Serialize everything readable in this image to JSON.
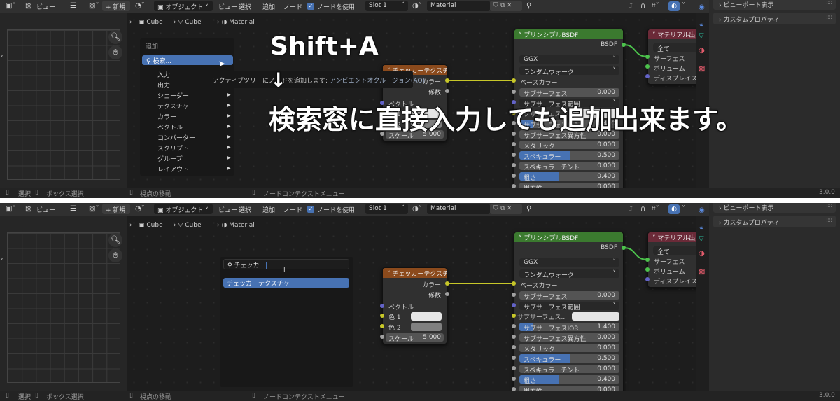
{
  "header": {
    "image_editor": {
      "view": "ビュー",
      "new": "新規"
    },
    "node_editor": {
      "mode": "オブジェクト",
      "menus": [
        "ビュー",
        "選択",
        "追加",
        "ノード"
      ],
      "use_nodes_label": "ノードを使用",
      "use_nodes_checked": true,
      "slot": "Slot 1",
      "material": "Material"
    }
  },
  "breadcrumb": [
    "Cube",
    "Cube",
    "Material"
  ],
  "properties": {
    "sections": [
      "ビューポート表示",
      "カスタムプロパティ"
    ]
  },
  "status": {
    "select": "選択",
    "box_select": "ボックス選択",
    "pan": "視点の移動",
    "context_menu": "ノードコンテクストメニュー",
    "version": "3.0.0"
  },
  "checker_node": {
    "title": "チェッカーテクスチャ",
    "outputs": [
      "カラー",
      "係数"
    ],
    "vector": "ベクトル",
    "color1": "色 1",
    "color2": "色 2",
    "color1_value": "#e6e6e6",
    "color2_value": "#808080",
    "scale_label": "スケール",
    "scale_value": "5.000"
  },
  "principled_node": {
    "title": "プリンシプルBSDF",
    "output": "BSDF",
    "distribution": "GGX",
    "subsurface_method": "ランダムウォーク",
    "base_color": "ベースカラー",
    "rows": [
      {
        "label": "サブサーフェス",
        "value": "0.000",
        "kind": "num",
        "fill": 0,
        "socket": "#a1a1a1"
      },
      {
        "label": "サブサーフェス範囲",
        "value": "",
        "kind": "select",
        "fill": 0,
        "socket": "#6363c7"
      },
      {
        "label": "サブサーフェス...",
        "value": "",
        "kind": "color",
        "fill": 0,
        "socket": "#c7c729"
      },
      {
        "label": "サブサーフェスIOR",
        "value": "1.400",
        "kind": "num",
        "fill": 0.14,
        "socket": "#a1a1a1"
      },
      {
        "label": "サブサーフェス異方性",
        "value": "0.000",
        "kind": "num",
        "fill": 0,
        "socket": "#a1a1a1"
      },
      {
        "label": "メタリック",
        "value": "0.000",
        "kind": "num",
        "fill": 0,
        "socket": "#a1a1a1"
      },
      {
        "label": "スペキュラー",
        "value": "0.500",
        "kind": "num",
        "fill": 0.5,
        "socket": "#a1a1a1"
      },
      {
        "label": "スペキュラーチント",
        "value": "0.000",
        "kind": "num",
        "fill": 0,
        "socket": "#a1a1a1"
      },
      {
        "label": "粗さ",
        "value": "0.400",
        "kind": "num",
        "fill": 0.4,
        "socket": "#a1a1a1"
      },
      {
        "label": "異方性",
        "value": "0.000",
        "kind": "num",
        "fill": 0,
        "socket": "#a1a1a1"
      }
    ]
  },
  "output_node": {
    "title": "マテリアル出力",
    "target": "全て",
    "inputs": [
      "サーフェス",
      "ボリューム",
      "ディスプレイスメント"
    ]
  },
  "add_menu": {
    "title": "追加",
    "search": "検索...",
    "items": [
      {
        "label": "入力",
        "submenu": false
      },
      {
        "label": "出力",
        "submenu": false
      },
      {
        "label": "シェーダー",
        "submenu": true
      },
      {
        "label": "テクスチャ",
        "submenu": true
      },
      {
        "label": "カラー",
        "submenu": true
      },
      {
        "label": "ベクトル",
        "submenu": true
      },
      {
        "label": "コンバーター",
        "submenu": true
      },
      {
        "label": "スクリプト",
        "submenu": true
      },
      {
        "label": "グループ",
        "submenu": true
      },
      {
        "label": "レイアウト",
        "submenu": true
      }
    ]
  },
  "tooltip": {
    "prefix": "アクティブツリーにノードを追加します:",
    "value": "アンビエントオクルージョン(AO)"
  },
  "overlay": {
    "shortcut": "Shift+A",
    "arrow": "↓",
    "caption": "検索窓に直接入力しても追加出来ます。"
  },
  "search_popup": {
    "query": "チェッカー",
    "result": "チェッカーテクスチャ"
  },
  "colors": {
    "accent": "#4772b3",
    "principled_header": "#3b7a2f",
    "checker_header": "#8b4a1c",
    "output_header": "#6b2a38",
    "link_color": "#c7c729",
    "shader_link": "#4cc24c"
  }
}
